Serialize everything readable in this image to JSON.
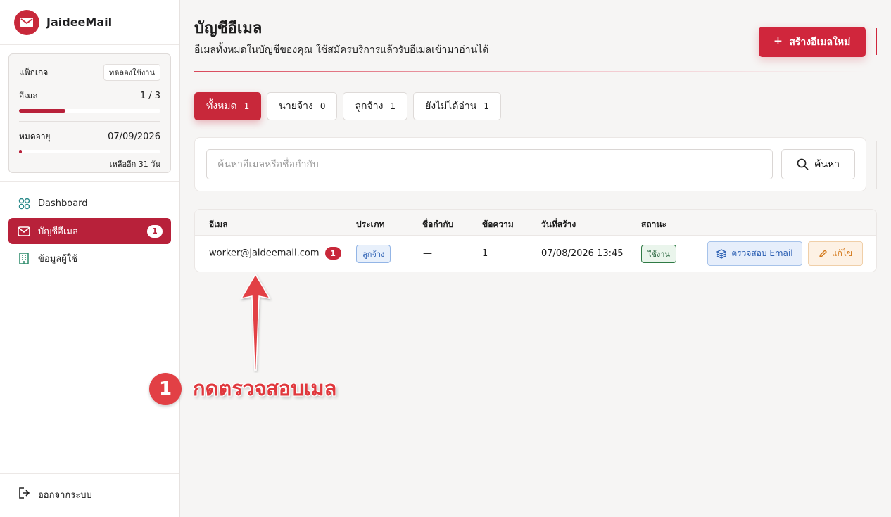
{
  "app": {
    "name": "JaideeMail"
  },
  "package": {
    "label": "แพ็กเกจ",
    "badge": "ทดลองใช้งาน",
    "email_label": "อีเมล",
    "email_value": "1 / 3",
    "email_fraction": 0.33,
    "expiry_label": "หมดอายุ",
    "expiry_value": "07/09/2026",
    "expiry_fraction": 0.02,
    "remaining": "เหลืออีก 31 วัน"
  },
  "nav": {
    "items": [
      {
        "label": "Dashboard",
        "icon": "grid-icon"
      },
      {
        "label": "บัญชีอีเมล",
        "icon": "mail-icon",
        "count": "1"
      },
      {
        "label": "ข้อมูลผู้ใช้",
        "icon": "building-icon"
      }
    ],
    "logout": "ออกจากระบบ"
  },
  "page": {
    "title": "บัญชีอีเมล",
    "subtitle": "อีเมลทั้งหมดในบัญชีของคุณ ใช้สมัครบริการแล้วรับอีเมลเข้ามาอ่านได้",
    "create_button": "สร้างอีเมลใหม่"
  },
  "tabs": [
    {
      "label": "ทั้งหมด",
      "count": "1"
    },
    {
      "label": "นายจ้าง",
      "count": "0"
    },
    {
      "label": "ลูกจ้าง",
      "count": "1"
    },
    {
      "label": "ยังไม่ได้อ่าน",
      "count": "1"
    }
  ],
  "search": {
    "placeholder": "ค้นหาอีเมลหรือชื่อกำกับ",
    "button": "ค้นหา"
  },
  "table": {
    "headers": [
      "อีเมล",
      "ประเภท",
      "ชื่อกำกับ",
      "ข้อความ",
      "วันที่สร้าง",
      "สถานะ"
    ],
    "rows": [
      {
        "email": "worker@jaideemail.com",
        "unread": "1",
        "type": "ลูกจ้าง",
        "alias": "—",
        "messages": "1",
        "created": "07/08/2026 13:45",
        "status": "ใช้งาน",
        "verify_button": "ตรวจสอบ Email",
        "edit_button": "แก้ไข"
      }
    ]
  },
  "annotation": {
    "number": "1",
    "text": "กดตรวจสอบเมล",
    "color": "#e0383d"
  },
  "colors": {
    "accent": "#c8283a",
    "background": "#f6f5f4"
  }
}
